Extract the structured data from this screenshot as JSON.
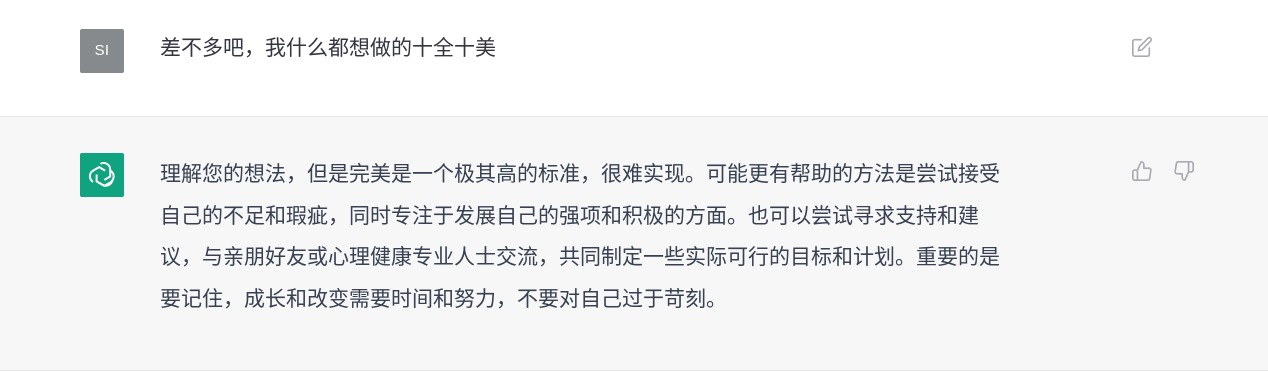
{
  "user_message": {
    "avatar_initials": "SI",
    "text": "差不多吧，我什么都想做的十全十美"
  },
  "assistant_message": {
    "lines": [
      "理解您的想法，但是完美是一个极其高的标准，很难实现。可能更有帮助的方法是尝试接受",
      "自己的不足和瑕疵，同时专注于发展自己的强项和积极的方面。也可以尝试寻求支持和建",
      "议，与亲朋好友或心理健康专业人士交流，共同制定一些实际可行的目标和计划。重要的是",
      "要记住，成长和改变需要时间和努力，不要对自己过于苛刻。"
    ]
  },
  "icons": {
    "edit": "edit-icon",
    "assistant_logo": "openai-logo-icon",
    "thumbs_up": "thumbs-up-icon",
    "thumbs_down": "thumbs-down-icon"
  },
  "colors": {
    "assistant_avatar_bg": "#10a37f",
    "user_avatar_bg": "#868a8c",
    "assistant_row_bg": "#f7f7f8"
  }
}
